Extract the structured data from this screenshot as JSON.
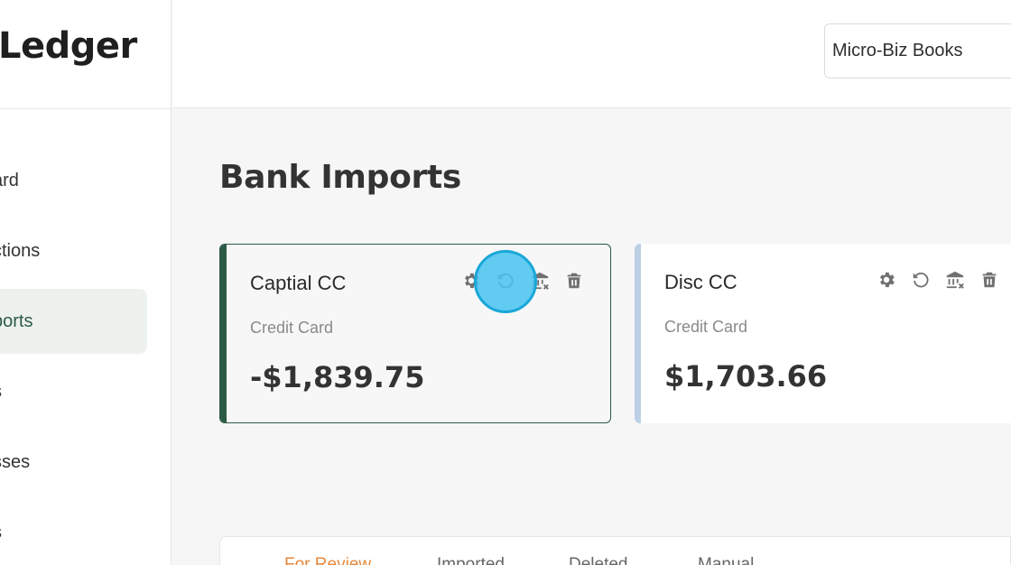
{
  "app": {
    "logo_text": "Ledger"
  },
  "sidebar": {
    "items": [
      {
        "label": "ard",
        "active": false
      },
      {
        "label": "ctions",
        "active": false
      },
      {
        "label": "ports",
        "active": true
      },
      {
        "label": "s",
        "active": false
      },
      {
        "label": "sses",
        "active": false
      },
      {
        "label": "s",
        "active": false
      }
    ]
  },
  "header": {
    "company_select_value": "Micro-Biz Books"
  },
  "main": {
    "title": "Bank Imports",
    "accounts": [
      {
        "name": "Captial CC",
        "type": "Credit Card",
        "balance": "-$1,839.75",
        "accent_color": "#2d5a44",
        "selected": true
      },
      {
        "name": "Disc CC",
        "type": "Credit Card",
        "balance": "$1,703.66",
        "accent_color": "#bcd0e6",
        "selected": false
      }
    ],
    "card_action_icons": [
      "gear-icon",
      "refresh-icon",
      "bank-unlink-icon",
      "trash-icon"
    ],
    "tabs": [
      {
        "label": "For Review",
        "active": true
      },
      {
        "label": "Imported",
        "active": false
      },
      {
        "label": "Deleted",
        "active": false
      },
      {
        "label": "Manual",
        "active": false
      }
    ]
  },
  "colors": {
    "brand_green": "#2d5a44",
    "tab_active": "#e8883a",
    "click_highlight": "#46c3f0"
  }
}
